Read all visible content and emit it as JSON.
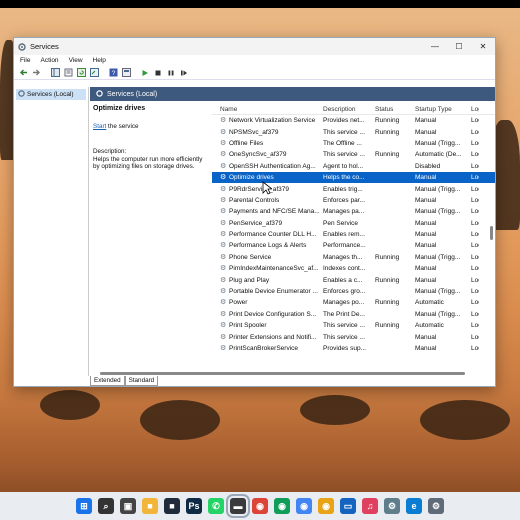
{
  "window": {
    "title": "Services",
    "menu": [
      "File",
      "Action",
      "View",
      "Help"
    ],
    "controls": {
      "minimize": "—",
      "maximize": "☐",
      "close": "✕"
    }
  },
  "tree": {
    "root": "Services (Local)"
  },
  "pane_header": "Services (Local)",
  "details": {
    "service_name": "Optimize drives",
    "action_link": "Start",
    "action_suffix": " the service",
    "description_label": "Description:",
    "description_text": "Helps the computer run more efficiently by optimizing files on storage drives."
  },
  "columns": [
    "Name",
    "Description",
    "Status",
    "Startup Type",
    "Log"
  ],
  "services": [
    {
      "name": "Network Virtualization Service",
      "desc": "Provides net...",
      "status": "Running",
      "startup": "Manual",
      "log": "Loc"
    },
    {
      "name": "NPSMSvc_af379",
      "desc": "This service ...",
      "status": "Running",
      "startup": "Manual",
      "log": "Loc"
    },
    {
      "name": "Offline Files",
      "desc": "The Offline ...",
      "status": "",
      "startup": "Manual (Trigg...",
      "log": "Loc"
    },
    {
      "name": "OneSyncSvc_af379",
      "desc": "This service ...",
      "status": "Running",
      "startup": "Automatic (De...",
      "log": "Loc"
    },
    {
      "name": "OpenSSH Authentication Ag...",
      "desc": "Agent to hol...",
      "status": "",
      "startup": "Disabled",
      "log": "Loc"
    },
    {
      "name": "Optimize drives",
      "desc": "Helps the co...",
      "status": "",
      "startup": "Manual",
      "log": "Loc",
      "selected": true
    },
    {
      "name": "P9RdrService_af379",
      "desc": "Enables trig...",
      "status": "",
      "startup": "Manual (Trigg...",
      "log": "Loc"
    },
    {
      "name": "Parental Controls",
      "desc": "Enforces par...",
      "status": "",
      "startup": "Manual",
      "log": "Loc"
    },
    {
      "name": "Payments and NFC/SE Mana...",
      "desc": "Manages pa...",
      "status": "",
      "startup": "Manual (Trigg...",
      "log": "Loc"
    },
    {
      "name": "PenService_af379",
      "desc": "Pen Service",
      "status": "",
      "startup": "Manual",
      "log": "Loc"
    },
    {
      "name": "Performance Counter DLL H...",
      "desc": "Enables rem...",
      "status": "",
      "startup": "Manual",
      "log": "Loc"
    },
    {
      "name": "Performance Logs & Alerts",
      "desc": "Performance...",
      "status": "",
      "startup": "Manual",
      "log": "Loc"
    },
    {
      "name": "Phone Service",
      "desc": "Manages th...",
      "status": "Running",
      "startup": "Manual (Trigg...",
      "log": "Loc"
    },
    {
      "name": "PimIndexMaintenanceSvc_af...",
      "desc": "Indexes cont...",
      "status": "",
      "startup": "Manual",
      "log": "Loc"
    },
    {
      "name": "Plug and Play",
      "desc": "Enables a c...",
      "status": "Running",
      "startup": "Manual",
      "log": "Loc"
    },
    {
      "name": "Portable Device Enumerator ...",
      "desc": "Enforces gro...",
      "status": "",
      "startup": "Manual (Trigg...",
      "log": "Loc"
    },
    {
      "name": "Power",
      "desc": "Manages po...",
      "status": "Running",
      "startup": "Automatic",
      "log": "Loc"
    },
    {
      "name": "Print Device Configuration S...",
      "desc": "The Print De...",
      "status": "",
      "startup": "Manual (Trigg...",
      "log": "Loc"
    },
    {
      "name": "Print Spooler",
      "desc": "This service ...",
      "status": "Running",
      "startup": "Automatic",
      "log": "Loc"
    },
    {
      "name": "Printer Extensions and Notifi...",
      "desc": "This service ...",
      "status": "",
      "startup": "Manual",
      "log": "Loc"
    },
    {
      "name": "PrintScanBrokerService",
      "desc": "Provides sup...",
      "status": "",
      "startup": "Manual",
      "log": "Loc"
    }
  ],
  "tabs": [
    "Extended",
    "Standard"
  ],
  "taskbar": [
    {
      "name": "start-icon",
      "glyph": "⊞",
      "color": "#1a73e8"
    },
    {
      "name": "search-icon",
      "glyph": "⌕",
      "color": "#333"
    },
    {
      "name": "task-view-icon",
      "glyph": "▣",
      "color": "#444"
    },
    {
      "name": "file-explorer-icon",
      "glyph": "■",
      "color": "#f2b53a"
    },
    {
      "name": "file-manager-icon",
      "glyph": "■",
      "color": "#1f2a3a"
    },
    {
      "name": "photoshop-icon",
      "glyph": "Ps",
      "color": "#0f2a44"
    },
    {
      "name": "whatsapp-icon",
      "glyph": "✆",
      "color": "#25d366"
    },
    {
      "name": "notes-icon",
      "glyph": "▬",
      "color": "#3a3a3a"
    },
    {
      "name": "chrome-icon",
      "glyph": "◉",
      "color": "#db4437"
    },
    {
      "name": "chrome-profile-icon",
      "glyph": "◉",
      "color": "#0f9d58"
    },
    {
      "name": "chrome-dev-icon",
      "glyph": "◉",
      "color": "#4285f4"
    },
    {
      "name": "chrome-canary-icon",
      "glyph": "◉",
      "color": "#e8a317"
    },
    {
      "name": "monitor-icon",
      "glyph": "▭",
      "color": "#1565c0"
    },
    {
      "name": "music-icon",
      "glyph": "♫",
      "color": "#e04060"
    },
    {
      "name": "settings-icon",
      "glyph": "⚙",
      "color": "#607d8b"
    },
    {
      "name": "edge-icon",
      "glyph": "e",
      "color": "#0a7cd1"
    },
    {
      "name": "gear-icon",
      "glyph": "⚙",
      "color": "#5f6b78"
    }
  ]
}
